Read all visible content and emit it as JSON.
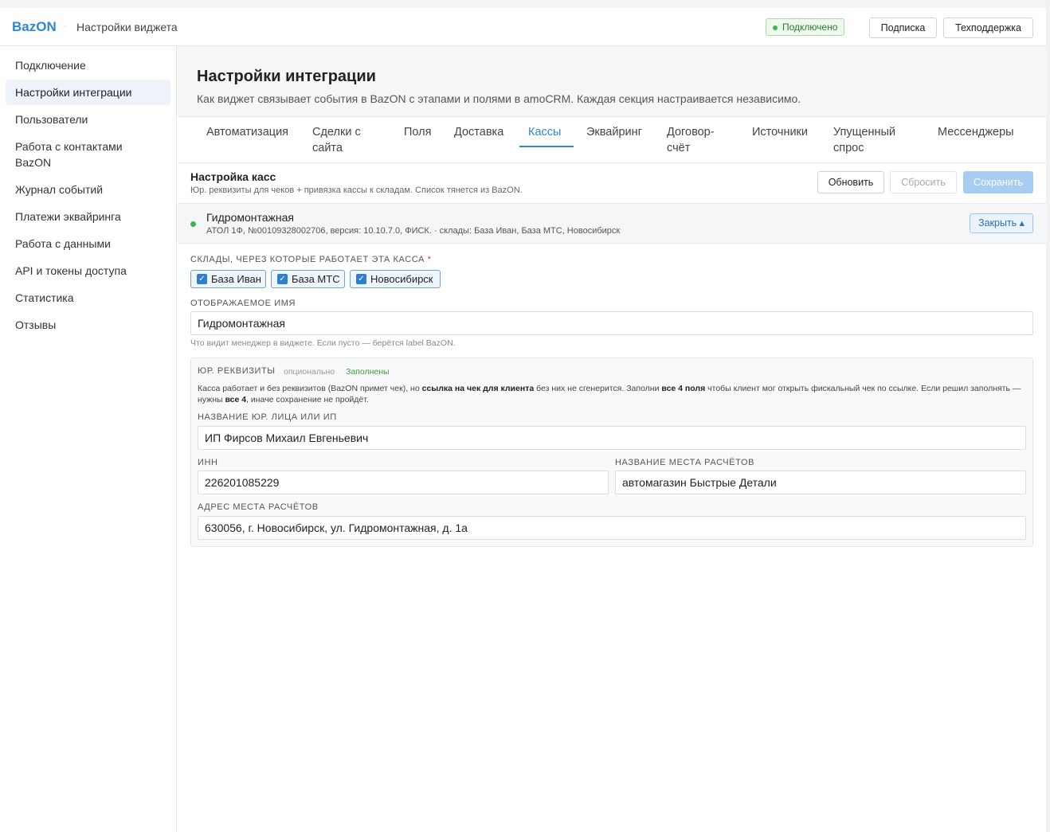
{
  "header": {
    "brand": "BazON",
    "separator": "·",
    "title": "Настройки виджета",
    "status": "Подключено",
    "subscription_label": "Подписка",
    "support_label": "Техподдержка"
  },
  "sidebar": {
    "items": [
      {
        "label": "Подключение"
      },
      {
        "label": "Настройки интеграции",
        "active": true
      },
      {
        "label": "Пользователи"
      },
      {
        "label": "Работа с контактами BazON"
      },
      {
        "label": "Журнал событий"
      },
      {
        "label": "Платежи эквайринга"
      },
      {
        "label": "Работа с данными"
      },
      {
        "label": "API и токены доступа"
      },
      {
        "label": "Статистика"
      },
      {
        "label": "Отзывы"
      }
    ]
  },
  "main": {
    "title": "Настройки интеграции",
    "subtitle": "Как виджет связывает события в BazON с этапами и полями в amoCRM. Каждая секция настраивается независимо.",
    "tabs": [
      {
        "label": "Автоматизация"
      },
      {
        "label": "Сделки с сайта"
      },
      {
        "label": "Поля"
      },
      {
        "label": "Доставка"
      },
      {
        "label": "Кассы",
        "active": true
      },
      {
        "label": "Эквайринг"
      },
      {
        "label": "Договор-счёт"
      },
      {
        "label": "Источники"
      },
      {
        "label": "Упущенный спрос"
      },
      {
        "label": "Мессенджеры"
      }
    ]
  },
  "section": {
    "title": "Настройка касс",
    "subtitle": "Юр. реквизиты для чеков + привязка кассы к складам. Список тянется из BazON.",
    "refresh_label": "Обновить",
    "reset_label": "Сбросить",
    "save_label": "Сохранить"
  },
  "kassa": {
    "name": "Гидромонтажная",
    "meta": "АТОЛ 1Ф, №00109328002706, версия: 10.10.7.0, ФИСК. · склады: База Иван, База МТС, Новосибирск",
    "close_label": "Закрыть ▴",
    "status_color": "#3cb54a"
  },
  "warehouses": {
    "label": "СКЛАДЫ, ЧЕРЕЗ КОТОРЫЕ РАБОТАЕТ ЭТА КАССА",
    "required_mark": "*",
    "items": [
      {
        "label": "База Иван",
        "checked": true
      },
      {
        "label": "База МТС",
        "checked": true
      },
      {
        "label": "Новосибирск",
        "checked": true
      }
    ]
  },
  "display_name": {
    "label": "ОТОБРАЖАЕМОЕ ИМЯ",
    "value": "Гидромонтажная",
    "hint": "Что видит менеджер в виджете. Если пусто — берётся label BazON."
  },
  "legal": {
    "label": "ЮР. РЕКВИЗИТЫ",
    "optional": "опционально",
    "status": "Заполнены",
    "note_1": "Касса работает и без реквизитов (BazON примет чек), но ",
    "note_b1": "ссылка на чек для клиента",
    "note_2": " без них не сгенерится. Заполни ",
    "note_b2": "все 4 поля",
    "note_3": " чтобы клиент мог открыть фискальный чек по ссылке. Если решил заполнять — нужны ",
    "note_b3": "все 4",
    "note_4": ", иначе сохранение не пройдёт.",
    "entity_label": "НАЗВАНИЕ ЮР. ЛИЦА ИЛИ ИП",
    "entity_value": "ИП Фирсов Михаил Евгеньевич",
    "inn_label": "ИНН",
    "inn_value": "226201085229",
    "place_name_label": "НАЗВАНИЕ МЕСТА РАСЧЁТОВ",
    "place_name_value": "автомагазин Быстрые Детали",
    "address_label": "АДРЕС МЕСТА РАСЧЁТОВ",
    "address_value": "630056, г. Новосибирск, ул. Гидромонтажная, д. 1а"
  },
  "colors": {
    "accent": "#2f86d6",
    "success": "#3cb54a"
  }
}
